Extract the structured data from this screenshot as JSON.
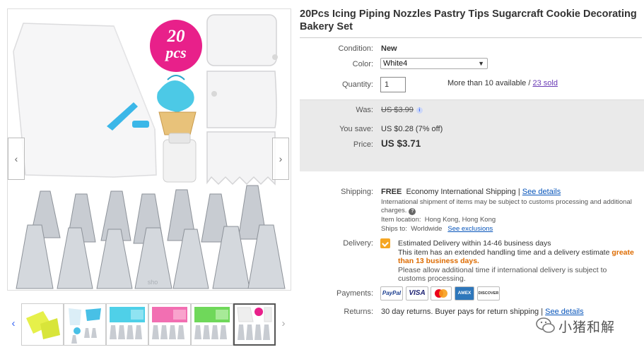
{
  "product": {
    "title": "20Pcs Icing Piping Nozzles Pastry Tips Sugarcraft Cookie Decorating Bakery Set",
    "image_badge": {
      "line1": "20",
      "line2": "pcs"
    },
    "watermark_code": "sho"
  },
  "gallery": {
    "prev_icon": "chevron-left-icon",
    "next_icon": "chevron-right-icon",
    "thumb_count": 6,
    "selected_thumb": 6
  },
  "details": {
    "condition_label": "Condition:",
    "condition_value": "New",
    "color_label": "Color:",
    "color_value": "White4",
    "quantity_label": "Quantity:",
    "quantity_value": "1",
    "availability": "More than 10 available /",
    "sold": "23 sold"
  },
  "price": {
    "was_label": "Was:",
    "was_value": "US $3.99",
    "save_label": "You save:",
    "save_value": "US $0.28 (7% off)",
    "price_label": "Price:",
    "price_value": "US $3.71"
  },
  "shipping": {
    "label": "Shipping:",
    "free": "FREE",
    "method": "Economy International Shipping |",
    "see_details": "See details",
    "customs_line1": "International shipment of items may be subject to customs processing and additional",
    "customs_line2": "charges.",
    "location_label": "Item location:",
    "location_value": "Hong Kong, Hong Kong",
    "ships_label": "Ships to:",
    "ships_value": "Worldwide",
    "exclusions": "See exclusions"
  },
  "delivery": {
    "label": "Delivery:",
    "estimate": "Estimated Delivery within 14-46 business days",
    "handling_part1": "This item has an extended handling time and a delivery estimate",
    "handling_highlight_1": "greate",
    "handling_highlight_2": "than 13 business days.",
    "note_line1": "Please allow additional time if international delivery is subject to",
    "note_line2": "customs processing."
  },
  "payments": {
    "label": "Payments:",
    "methods": [
      "PayPal",
      "VISA",
      "MasterCard",
      "AMEX",
      "DISCOVER"
    ]
  },
  "returns": {
    "label": "Returns:",
    "text": "30 day returns. Buyer pays for return shipping |",
    "see_details": "See details"
  },
  "watermark": {
    "text": "小猪和解"
  },
  "colors": {
    "link": "#0654ba",
    "price_box_bg": "#eaeaea",
    "highlight_orange": "#dd6b00",
    "badge_pink": "#e8208a",
    "frosting_blue": "#4cc9e6",
    "nozzle_steel": "#c8ccd2"
  }
}
